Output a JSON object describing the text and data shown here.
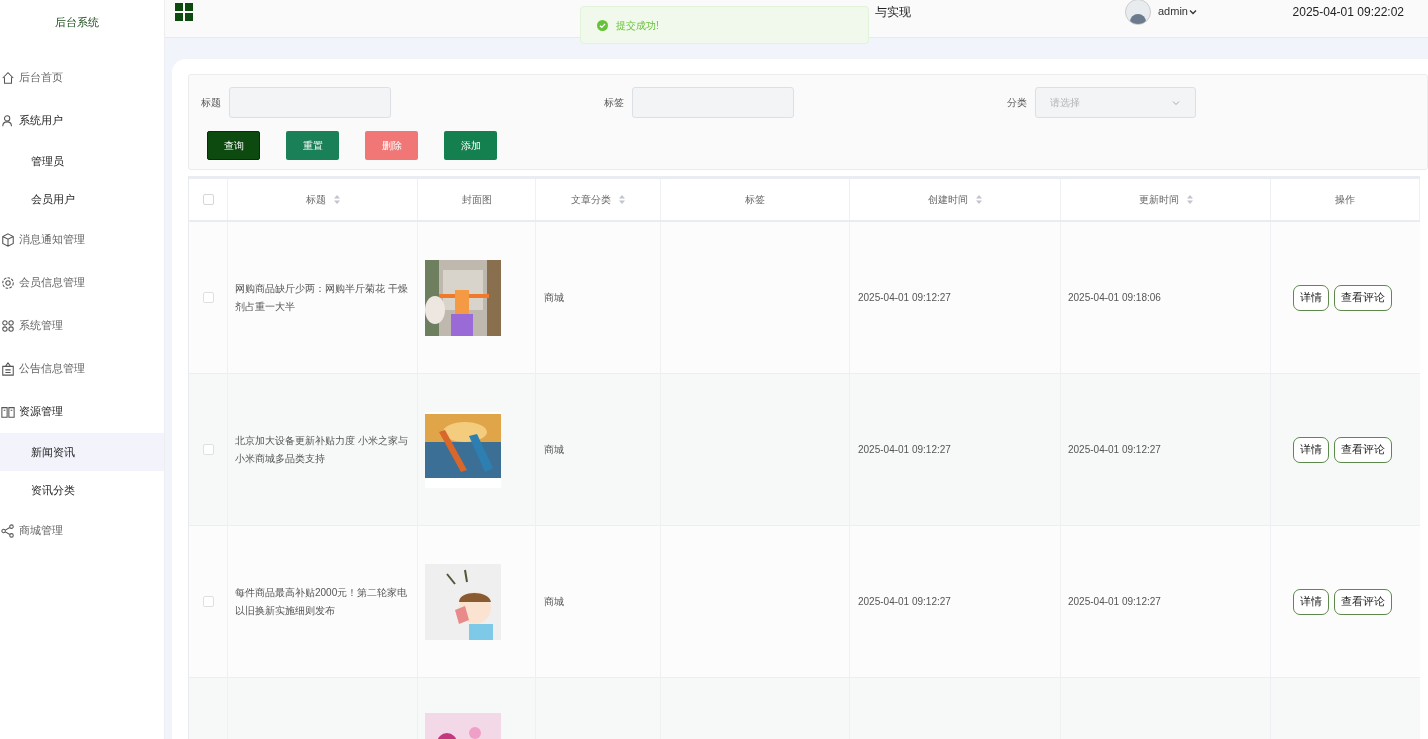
{
  "sidebar": {
    "title": "后台系统",
    "items": [
      {
        "label": "后台首页",
        "selected": false
      },
      {
        "label": "系统用户",
        "selected": false,
        "expanded": true,
        "children": [
          {
            "label": "管理员",
            "selected": false
          },
          {
            "label": "会员用户",
            "selected": false
          }
        ]
      },
      {
        "label": "消息通知管理",
        "selected": false
      },
      {
        "label": "会员信息管理",
        "selected": false
      },
      {
        "label": "系统管理",
        "selected": false
      },
      {
        "label": "公告信息管理",
        "selected": false
      },
      {
        "label": "资源管理",
        "selected": false,
        "expanded": true,
        "children": [
          {
            "label": "新闻资讯",
            "selected": true
          },
          {
            "label": "资讯分类",
            "selected": false
          }
        ]
      },
      {
        "label": "商城管理",
        "selected": false
      }
    ]
  },
  "header": {
    "title": "与实现",
    "user": "admin",
    "datetime": "2025-04-01 09:22:02"
  },
  "toast": {
    "message": "提交成功!"
  },
  "filters": [
    {
      "label": "标题",
      "kind": "input"
    },
    {
      "label": "标签",
      "kind": "input"
    },
    {
      "label": "分类",
      "kind": "select",
      "placeholder": "请选择"
    }
  ],
  "buttons": [
    {
      "label": "查询",
      "kind": "query"
    },
    {
      "label": "重置",
      "kind": "reset"
    },
    {
      "label": "删除",
      "kind": "delete"
    },
    {
      "label": "添加",
      "kind": "add"
    }
  ],
  "table": {
    "select_all_checked": false,
    "columns": [
      {
        "label": "标题",
        "sortable": true
      },
      {
        "label": "封面图",
        "sortable": false
      },
      {
        "label": "文章分类",
        "sortable": true
      },
      {
        "label": "标签",
        "sortable": false
      },
      {
        "label": "创建时间",
        "sortable": true
      },
      {
        "label": "更新时间",
        "sortable": true
      },
      {
        "label": "操作",
        "sortable": false
      }
    ],
    "rows": [
      {
        "checked": false,
        "title": "网购商品缺斤少两：网购半斤菊花 干燥剂占重一大半",
        "cover": {
          "kind": "picture"
        },
        "category": "商城",
        "created": "2025-04-01 09:12:27",
        "updated": "2025-04-01 09:18:06",
        "actions": [
          "详情",
          "查看评论"
        ]
      },
      {
        "checked": false,
        "title": "北京加大设备更新补贴力度 小米之家与小米商城多品类支持",
        "cover": {
          "kind": "picture"
        },
        "category": "商城",
        "created": "2025-04-01 09:12:27",
        "updated": "2025-04-01 09:12:27",
        "actions": [
          "详情",
          "查看评论"
        ]
      },
      {
        "checked": false,
        "title": "每件商品最高补贴2000元！第二轮家电以旧换新实施细则发布",
        "cover": {
          "kind": "picture"
        },
        "category": "商城",
        "created": "2025-04-01 09:12:27",
        "updated": "2025-04-01 09:12:27",
        "actions": [
          "详情",
          "查看评论"
        ]
      },
      {
        "cover": {
          "kind": "picture"
        }
      }
    ]
  }
}
